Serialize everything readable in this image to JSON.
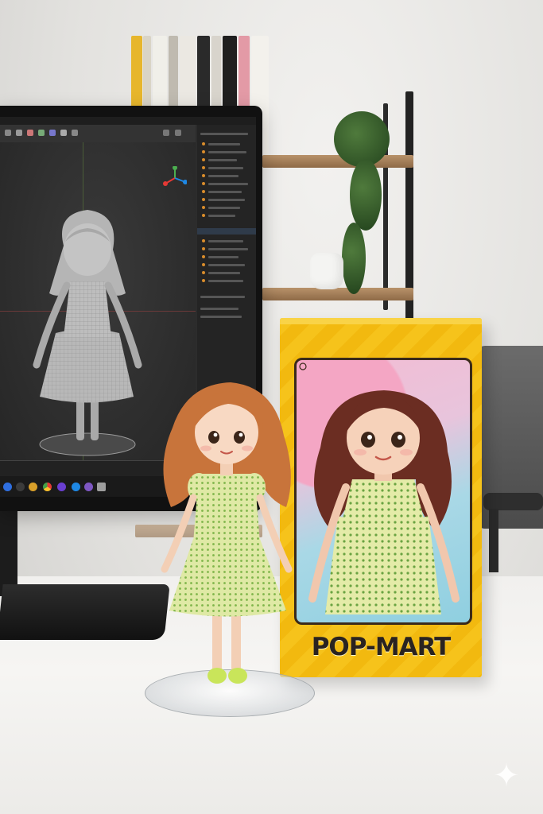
{
  "brand": {
    "text": "POP-MART"
  },
  "colors": {
    "box_yellow": "#f6c31b",
    "hair": "#c8743b",
    "dress": "#d9e79a",
    "screen_bg": "#2c2c2c"
  },
  "icons": {
    "sparkle": "✦"
  }
}
